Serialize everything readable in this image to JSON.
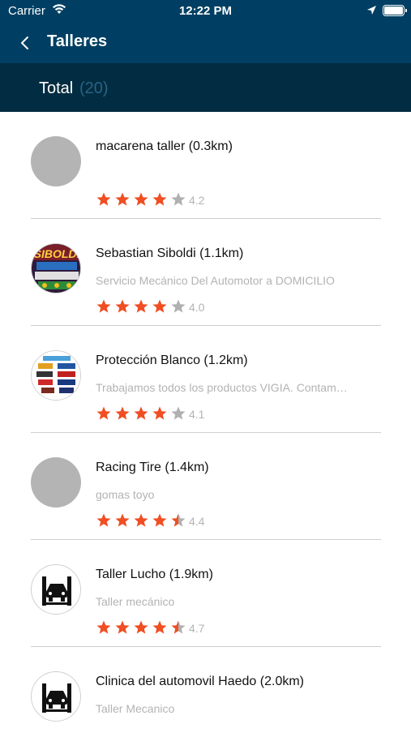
{
  "status_bar": {
    "carrier": "Carrier",
    "time": "12:22 PM"
  },
  "nav": {
    "title": "Talleres"
  },
  "summary": {
    "label": "Total",
    "count": "(20)"
  },
  "colors": {
    "nav_bg": "#003f63",
    "total_bg": "#022c41",
    "star_on": "#f04e23",
    "star_off": "#b0b0b0"
  },
  "workshops": [
    {
      "name": "macarena taller (0.3km)",
      "description": "",
      "rating": "4.2",
      "rating_value": 4.0,
      "avatar": "placeholder"
    },
    {
      "name": "Sebastian Siboldi (1.1km)",
      "description": "Servicio Mecánico Del Automotor a DOMICILIO",
      "rating": "4.0",
      "rating_value": 4.0,
      "avatar": "siboldi-logo-icon"
    },
    {
      "name": "Protección Blanco  (1.2km)",
      "description": "Trabajamos todos los productos VIGIA. Contam…",
      "rating": "4.1",
      "rating_value": 4.0,
      "avatar": "brands-logo-icon"
    },
    {
      "name": "Racing Tire (1.4km)",
      "description": "gomas toyo",
      "rating": "4.4",
      "rating_value": 4.5,
      "avatar": "placeholder"
    },
    {
      "name": "Taller Lucho (1.9km)",
      "description": "Taller mecánico",
      "rating": "4.7",
      "rating_value": 4.5,
      "avatar": "car-lift-icon"
    },
    {
      "name": "Clinica del automovil Haedo (2.0km)",
      "description": "Taller Mecanico",
      "rating": "",
      "rating_value": 0,
      "avatar": "car-lift-icon"
    }
  ]
}
